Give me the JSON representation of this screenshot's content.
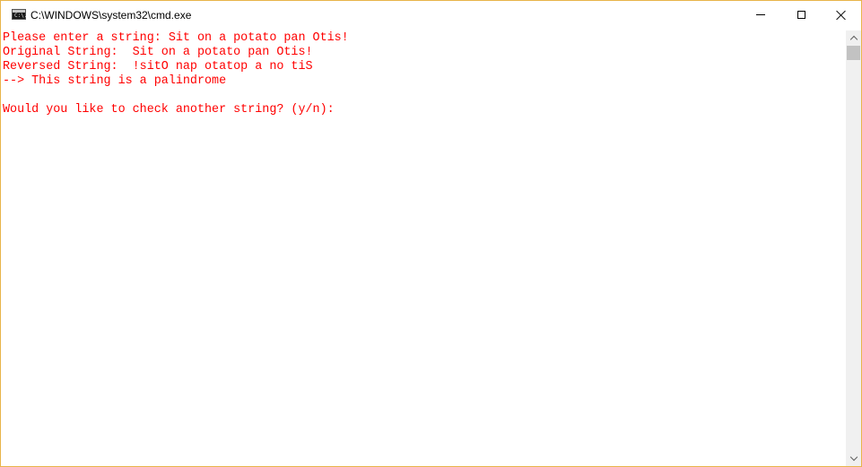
{
  "window": {
    "title": "C:\\WINDOWS\\system32\\cmd.exe",
    "icon": "cmd-icon",
    "icon_glyph": "C:\\."
  },
  "controls": {
    "minimize": "minimize-icon",
    "maximize": "maximize-icon",
    "close": "close-icon"
  },
  "console": {
    "text_color": "#ff0000",
    "background_color": "#ffffff",
    "lines": [
      "Please enter a string: Sit on a potato pan Otis!",
      "Original String:  Sit on a potato pan Otis!",
      "Reversed String:  !sitO nap otatop a no tiS",
      "--> This string is a palindrome",
      "",
      "Would you like to check another string? (y/n):"
    ]
  }
}
